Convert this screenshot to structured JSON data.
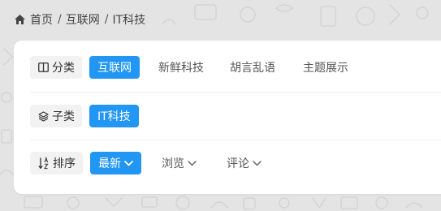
{
  "breadcrumb": {
    "home": "首页",
    "items": [
      "互联网",
      "IT科技"
    ],
    "separator": "/"
  },
  "filters": {
    "category": {
      "label": "分类",
      "icon": "columns-icon",
      "options": [
        "互联网",
        "新鲜科技",
        "胡言乱语",
        "主题展示"
      ],
      "selected": "互联网"
    },
    "subcategory": {
      "label": "子类",
      "icon": "layers-icon",
      "options": [
        "IT科技"
      ],
      "selected": "IT科技"
    },
    "sort": {
      "label": "排序",
      "icon": "sort-az-icon",
      "options": [
        "最新",
        "浏览",
        "评论"
      ],
      "selected": "最新"
    }
  },
  "colors": {
    "accent": "#2196f3",
    "background": "#e4e4e4",
    "card": "#ffffff",
    "label_bg": "#f2f2f2"
  }
}
